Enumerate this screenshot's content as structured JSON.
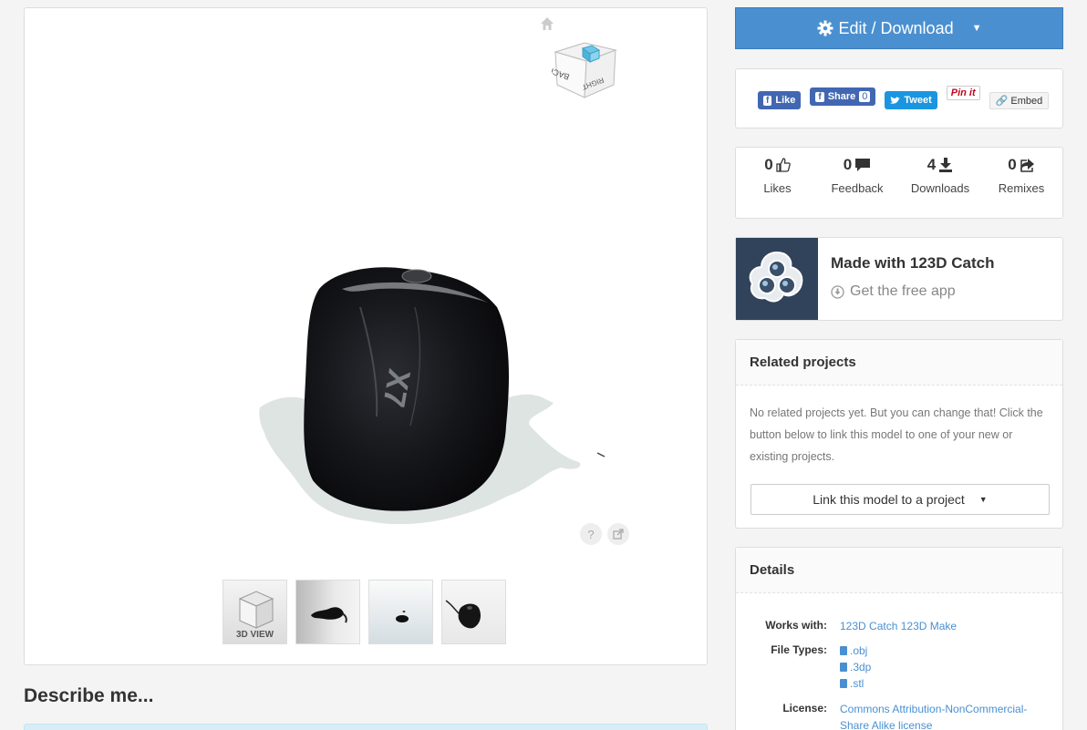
{
  "viewer": {
    "viewcube_faces": [
      "RIGHT",
      "BACK"
    ],
    "help_label": "?",
    "thumbnails": [
      {
        "kind": "3d-view",
        "caption": "3D VIEW"
      },
      {
        "kind": "photo"
      },
      {
        "kind": "photo"
      },
      {
        "kind": "photo"
      }
    ]
  },
  "describe": {
    "title": "Describe me..."
  },
  "edit_download": {
    "label": "Edit / Download"
  },
  "social": {
    "like": "Like",
    "share": "Share",
    "share_count": "0",
    "tweet": "Tweet",
    "pinit": "Pin it",
    "embed": "Embed"
  },
  "stats": {
    "likes": {
      "value": "0",
      "label": "Likes"
    },
    "feedback": {
      "value": "0",
      "label": "Feedback"
    },
    "downloads": {
      "value": "4",
      "label": "Downloads"
    },
    "remixes": {
      "value": "0",
      "label": "Remixes"
    }
  },
  "made_with": {
    "title": "Made with 123D Catch",
    "subtitle": "Get the free app"
  },
  "related": {
    "title": "Related projects",
    "text": "No related projects yet. But you can change that! Click the button below to link this model to one of your new or existing projects.",
    "link_button": "Link this model to a project"
  },
  "details": {
    "title": "Details",
    "works_with_label": "Works with:",
    "works_with": [
      "123D Catch",
      "123D Make"
    ],
    "file_types_label": "File Types:",
    "file_types": [
      ".obj",
      ".3dp",
      ".stl"
    ],
    "license_label": "License:",
    "license_line1": "Commons Attribution-NonCommercial-",
    "license_line2": "Share Alike license"
  },
  "colors": {
    "accent": "#4a90d1",
    "facebook": "#4267b2",
    "twitter": "#1b95e0",
    "pinterest": "#bd081c",
    "logo_bg": "#30435b"
  }
}
